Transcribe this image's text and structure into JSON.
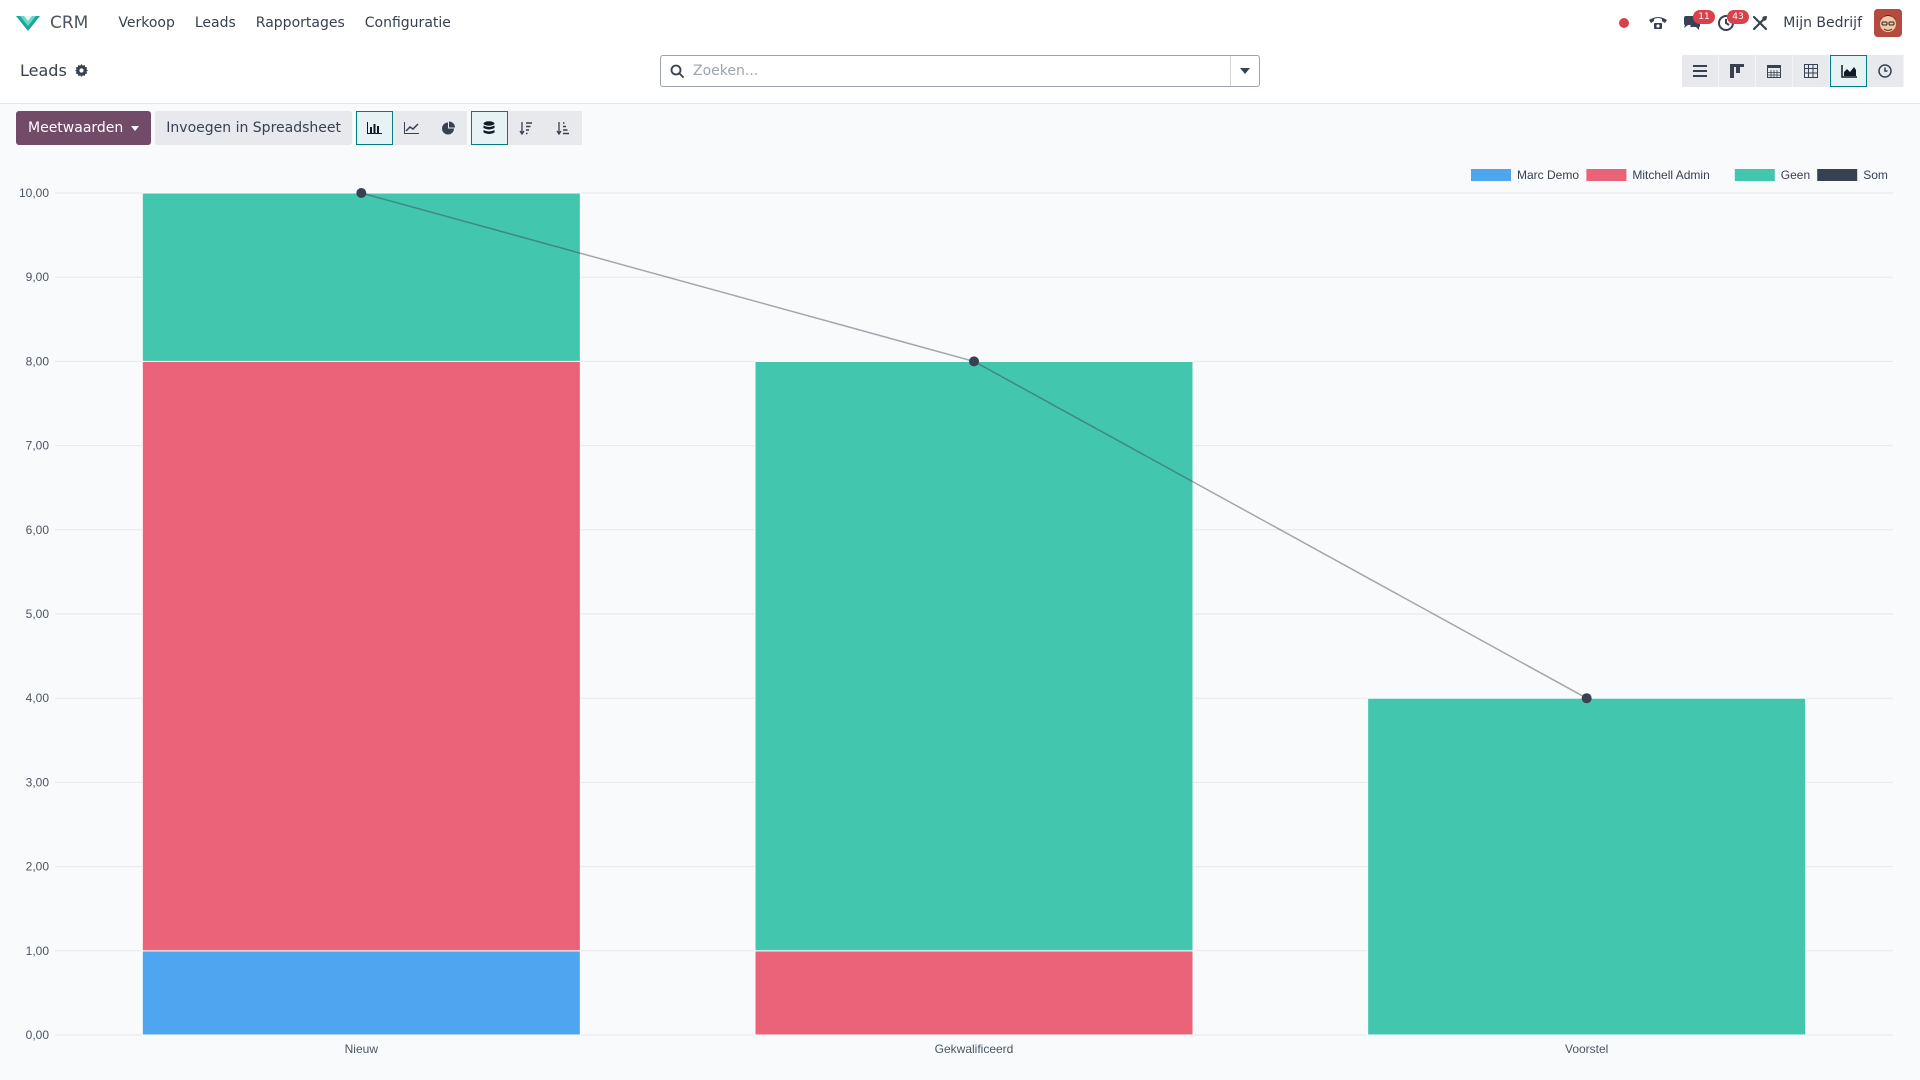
{
  "navbar": {
    "app_name": "CRM",
    "menu": [
      "Verkoop",
      "Leads",
      "Rapportages",
      "Configuratie"
    ],
    "chat_badge": "11",
    "activity_badge": "43",
    "company": "Mijn Bedrijf"
  },
  "control_panel": {
    "breadcrumb": "Leads",
    "search_placeholder": "Zoeken..."
  },
  "toolbar": {
    "measures_label": "Meetwaarden",
    "insert_spreadsheet_label": "Invoegen in Spreadsheet"
  },
  "chart_data": {
    "type": "bar",
    "stacked": true,
    "categories": [
      "Nieuw",
      "Gekwalificeerd",
      "Voorstel"
    ],
    "series": [
      {
        "name": "Marc Demo",
        "values": [
          1,
          0,
          0
        ],
        "color": "#4ea6f1"
      },
      {
        "name": "Mitchell Admin",
        "values": [
          7,
          1,
          0
        ],
        "color": "#eb6378"
      },
      {
        "name": "Geen",
        "values": [
          2,
          7,
          4
        ],
        "color": "#43c6ae"
      }
    ],
    "line_series": {
      "name": "Som",
      "values": [
        10,
        8,
        4
      ],
      "color": "#374151"
    },
    "y_ticks": [
      "0,00",
      "1,00",
      "2,00",
      "3,00",
      "4,00",
      "5,00",
      "6,00",
      "7,00",
      "8,00",
      "9,00",
      "10,00"
    ],
    "ylim": [
      0,
      10
    ],
    "legend_position": "top-right",
    "grid": true
  }
}
